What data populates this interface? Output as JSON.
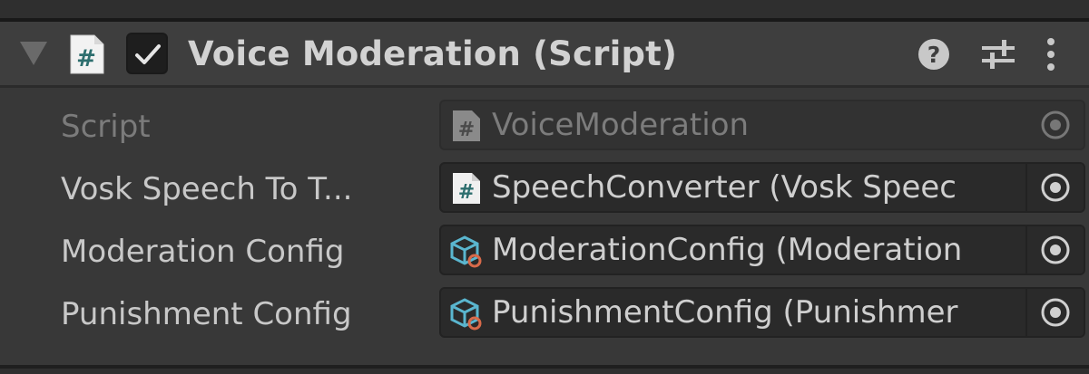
{
  "component": {
    "title": "Voice Moderation (Script)",
    "enabled": true,
    "header_icons": [
      "foldout-arrow-icon",
      "script-file-icon",
      "help-icon",
      "presets-icon",
      "kebab-menu-icon"
    ]
  },
  "properties": [
    {
      "label": "Script",
      "value": "VoiceModeration",
      "icon": "script-file-icon",
      "disabled": true
    },
    {
      "label": "Vosk Speech To T...",
      "value": "SpeechConverter (Vosk Speec",
      "icon": "script-file-icon",
      "disabled": false
    },
    {
      "label": "Moderation Config",
      "value": "ModerationConfig (Moderation",
      "icon": "scriptable-object-icon",
      "disabled": false
    },
    {
      "label": "Punishment Config",
      "value": "PunishmentConfig (Punishmer",
      "icon": "scriptable-object-icon",
      "disabled": false
    }
  ],
  "colors": {
    "panel_bg": "#383838",
    "header_bg": "#3e3e3e",
    "field_bg": "#2a2a2a",
    "text": "#d2d2d2",
    "disabled_text": "#7b7b7b"
  }
}
